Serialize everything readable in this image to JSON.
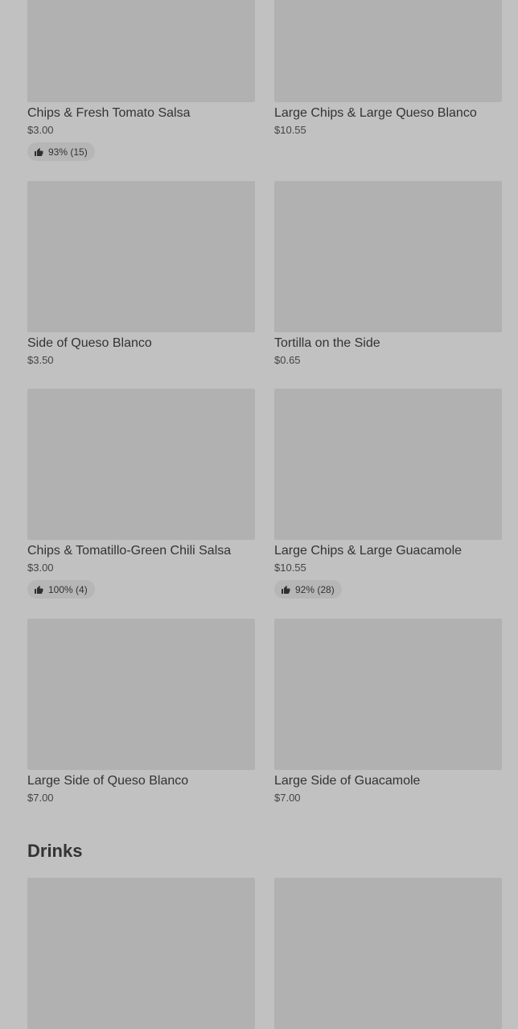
{
  "items": [
    {
      "name": "Chips & Fresh Tomato Salsa",
      "price": "$3.00",
      "rating": "93% (15)"
    },
    {
      "name": "Large Chips & Large Queso Blanco",
      "price": "$10.55"
    },
    {
      "name": "Side of Queso Blanco",
      "price": "$3.50"
    },
    {
      "name": "Tortilla on the Side",
      "price": "$0.65"
    },
    {
      "name": "Chips & Tomatillo-Green Chili Salsa",
      "price": "$3.00",
      "rating": "100% (4)"
    },
    {
      "name": "Large Chips & Large Guacamole",
      "price": "$10.55",
      "rating": "92% (28)"
    },
    {
      "name": "Large Side of Queso Blanco",
      "price": "$7.00"
    },
    {
      "name": "Large Side of Guacamole",
      "price": "$7.00"
    }
  ],
  "sections": {
    "drinks_title": "Drinks"
  },
  "icons": {
    "rating": "thumbs-up-icon"
  },
  "colors": {
    "background": "#c1c1c1",
    "image_placeholder": "#b1b1b1",
    "rating_pill": "#b6b6b6"
  }
}
